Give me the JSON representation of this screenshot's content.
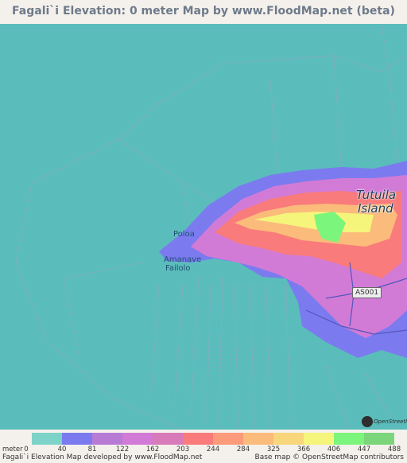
{
  "title": "Fagali`i Elevation: 0 meter Map by www.FloodMap.net (beta)",
  "map": {
    "island_label_line1": "Tutuila",
    "island_label_line2": "Island",
    "places": [
      "Poloa",
      "Amanave",
      "Failolo"
    ],
    "road_shield": "AS001",
    "osm_text": "OpenStreetMap",
    "colors": {
      "sea": "#5bbcbc"
    }
  },
  "legend": {
    "unit": "meter",
    "values": [
      "0",
      "40",
      "81",
      "122",
      "162",
      "203",
      "244",
      "284",
      "325",
      "366",
      "406",
      "447",
      "488"
    ],
    "colors": [
      "#7ed3c8",
      "#7b7bef",
      "#b77bd6",
      "#d27bd6",
      "#d87bb8",
      "#f97b7b",
      "#fb9b7b",
      "#fbbb7b",
      "#f8d67b",
      "#f5f57b",
      "#7bf57b",
      "#7bd67b"
    ]
  },
  "footer": {
    "left": "Fagali`i Elevation Map developed by www.FloodMap.net",
    "right": "Base map © OpenStreetMap contributors"
  }
}
